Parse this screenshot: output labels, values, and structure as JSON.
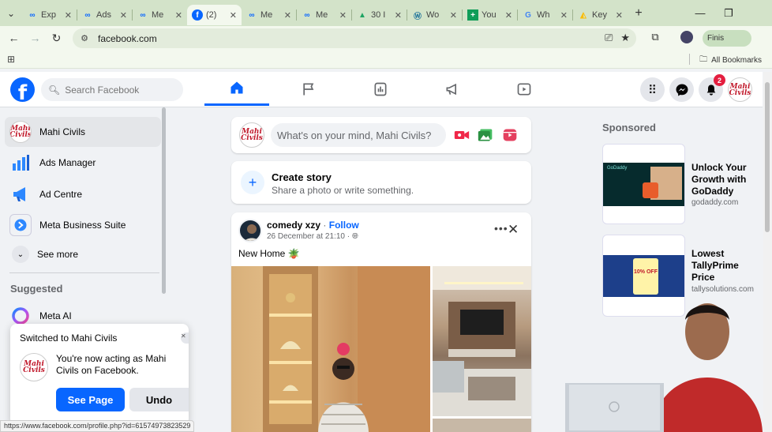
{
  "browser": {
    "tabs": [
      {
        "title": "Exp",
        "icon": "meta-icon"
      },
      {
        "title": "Ads",
        "icon": "meta-icon"
      },
      {
        "title": "Me",
        "icon": "meta-icon"
      },
      {
        "title": "(2) ",
        "icon": "facebook-icon",
        "active": true
      },
      {
        "title": "Me",
        "icon": "meta-icon"
      },
      {
        "title": "Me",
        "icon": "meta-icon"
      },
      {
        "title": "30 I",
        "icon": "drive-icon"
      },
      {
        "title": "Wo",
        "icon": "wordpress-icon"
      },
      {
        "title": "You",
        "icon": "sheets-icon"
      },
      {
        "title": "Wh",
        "icon": "google-icon"
      },
      {
        "title": "Key",
        "icon": "ads-icon"
      }
    ],
    "url": "facebook.com",
    "finish_label": "Finis",
    "all_bookmarks": "All Bookmarks",
    "status_url": "https://www.facebook.com/profile.php?id=61574973823529"
  },
  "header": {
    "search_placeholder": "Search Facebook",
    "notification_count": "2"
  },
  "left_nav": {
    "items": [
      {
        "label": "Mahi Civils"
      },
      {
        "label": "Ads Manager"
      },
      {
        "label": "Ad Centre"
      },
      {
        "label": "Meta Business Suite"
      },
      {
        "label": "See more"
      }
    ],
    "suggested_heading": "Suggested",
    "suggested": [
      {
        "label": "Meta AI"
      }
    ]
  },
  "toast": {
    "title": "Switched to Mahi Civils",
    "message": "You're now acting as Mahi Civils on Facebook.",
    "primary": "See Page",
    "secondary": "Undo"
  },
  "composer": {
    "placeholder": "What's on your mind, Mahi Civils?"
  },
  "story": {
    "title": "Create story",
    "subtitle": "Share a photo or write something."
  },
  "post": {
    "author": "comedy xzy",
    "separator": "·",
    "follow": "Follow",
    "date": "26 December at 21:10 ·",
    "text": "New Home 🪴"
  },
  "sponsored": {
    "heading": "Sponsored",
    "ads": [
      {
        "title": "Unlock Your Growth with GoDaddy",
        "url": "godaddy.com",
        "thumb_text": "GoDaddy"
      },
      {
        "title": "Lowest TallyPrime Price",
        "url": "tallysolutions.com",
        "thumb_text": "10% OFF"
      }
    ]
  },
  "avatar": {
    "line1": "Mahi",
    "line2": "Civils"
  },
  "colors": {
    "brand": "#0866ff",
    "badge": "#e41e3f"
  }
}
